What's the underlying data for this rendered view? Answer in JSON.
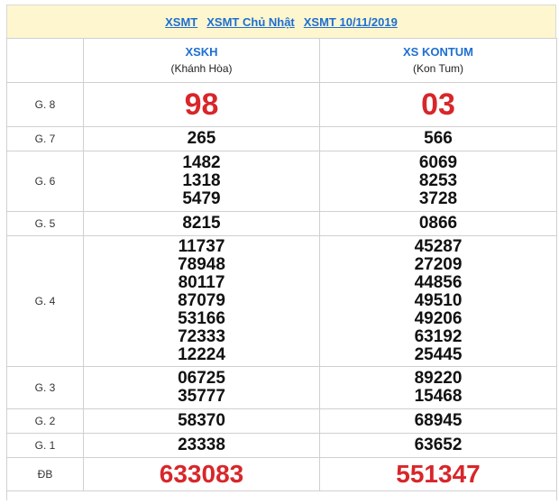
{
  "nav": {
    "link1": "XSMT",
    "link2": "XSMT Chủ Nhật",
    "link3": "XSMT 10/11/2019"
  },
  "provinces": [
    {
      "code": "XSKH",
      "name": "(Khánh Hòa)"
    },
    {
      "code": "XS KONTUM",
      "name": "(Kon Tum)"
    }
  ],
  "labels": {
    "g8": "G. 8",
    "g7": "G. 7",
    "g6": "G. 6",
    "g5": "G. 5",
    "g4": "G. 4",
    "g3": "G. 3",
    "g2": "G. 2",
    "g1": "G. 1",
    "db": "ĐB"
  },
  "results": [
    {
      "g8": "98",
      "g7": "265",
      "g6": [
        "1482",
        "1318",
        "5479"
      ],
      "g5": "8215",
      "g4": [
        "11737",
        "78948",
        "80117",
        "87079",
        "53166",
        "72333",
        "12224"
      ],
      "g3": [
        "06725",
        "35777"
      ],
      "g2": "58370",
      "g1": "23338",
      "db": "633083"
    },
    {
      "g8": "03",
      "g7": "566",
      "g6": [
        "6069",
        "8253",
        "3728"
      ],
      "g5": "0866",
      "g4": [
        "45287",
        "27209",
        "44856",
        "49510",
        "49206",
        "63192",
        "25445"
      ],
      "g3": [
        "89220",
        "15468"
      ],
      "g2": "68945",
      "g1": "63652",
      "db": "551347"
    }
  ],
  "colors": {
    "link": "#1e6fd1",
    "highlight_number": "#d8262a",
    "header_bg": "#fdf6cf"
  }
}
